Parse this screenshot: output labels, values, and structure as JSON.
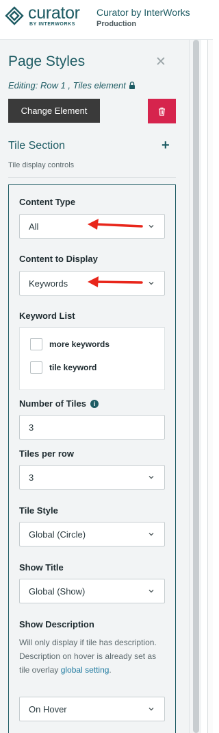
{
  "header": {
    "logo_word": "curator",
    "logo_sub": "BY INTERWORKS",
    "site_title": "Curator by InterWorks",
    "environment": "Production"
  },
  "panel": {
    "title": "Page Styles",
    "close_icon": "close-icon",
    "editing_text": "Editing: Row 1 , Tiles element",
    "lock_icon": "lock-icon",
    "change_element_label": "Change Element",
    "delete_icon": "trash-icon",
    "section_title": "Tile Section",
    "section_add_icon": "plus-icon",
    "section_subtitle": "Tile display controls"
  },
  "controls": {
    "content_type": {
      "label": "Content Type",
      "value": "All"
    },
    "content_to_display": {
      "label": "Content to Display",
      "value": "Keywords"
    },
    "keyword_list": {
      "label": "Keyword List",
      "items": [
        {
          "label": "more keywords",
          "checked": false
        },
        {
          "label": "tile keyword",
          "checked": false
        }
      ]
    },
    "number_of_tiles": {
      "label": "Number of Tiles",
      "value": "3",
      "info_icon": "info-icon"
    },
    "tiles_per_row": {
      "label": "Tiles per row",
      "value": "3"
    },
    "tile_style": {
      "label": "Tile Style",
      "value": "Global (Circle)"
    },
    "show_title": {
      "label": "Show Title",
      "value": "Global (Show)"
    },
    "show_description": {
      "label": "Show Description",
      "help_text": "Will only display if tile has description. Description on hover is already set as tile overlay",
      "help_link": "global setting",
      "help_end": ".",
      "value": "On Hover"
    }
  },
  "colors": {
    "brand": "#1d5b63",
    "delete": "#d6244d",
    "annotation_arrow": "#e8261b"
  }
}
